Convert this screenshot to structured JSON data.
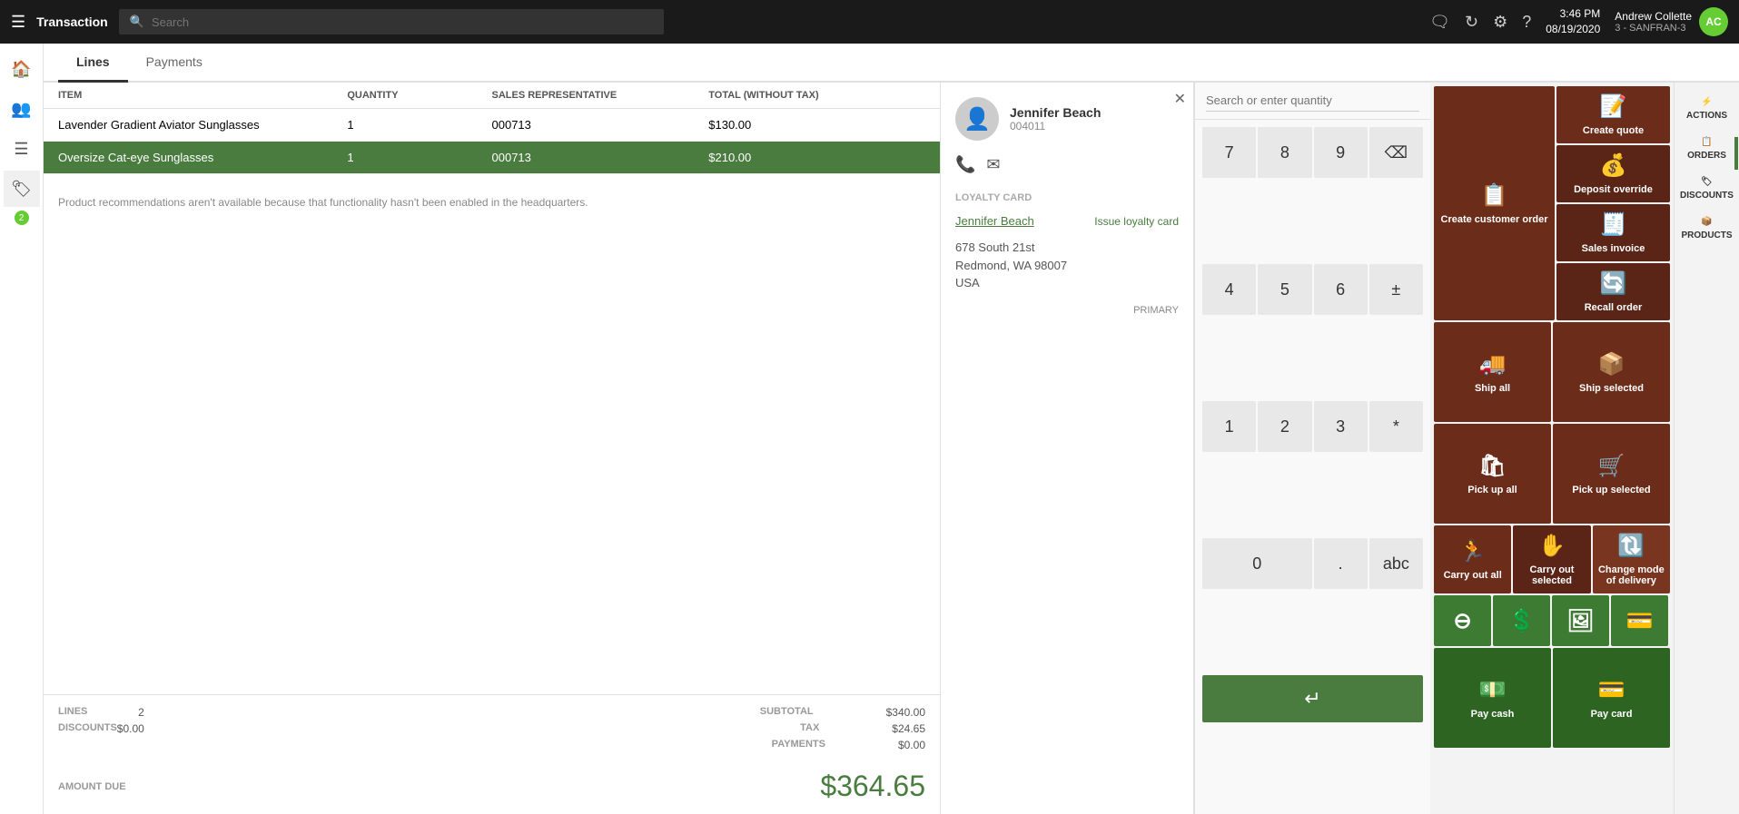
{
  "topbar": {
    "hamburger": "☰",
    "title": "Transaction",
    "search_placeholder": "Search",
    "time": "3:46 PM",
    "date": "08/19/2020",
    "user": "Andrew Collette",
    "store": "3 - SANFRAN-3",
    "avatar_initials": "AC"
  },
  "tabs": [
    {
      "label": "Lines",
      "active": true
    },
    {
      "label": "Payments",
      "active": false
    }
  ],
  "lines_header": {
    "item": "ITEM",
    "quantity": "QUANTITY",
    "sales_rep": "SALES REPRESENTATIVE",
    "total": "TOTAL (WITHOUT TAX)"
  },
  "line_items": [
    {
      "item": "Lavender Gradient Aviator Sunglasses",
      "quantity": "1",
      "sales_rep": "000713",
      "total": "$130.00",
      "selected": false
    },
    {
      "item": "Oversize Cat-eye Sunglasses",
      "quantity": "1",
      "sales_rep": "000713",
      "total": "$210.00",
      "selected": true
    }
  ],
  "notice": "Product recommendations aren't available because that functionality hasn't been enabled in the headquarters.",
  "footer": {
    "lines_label": "LINES",
    "lines_value": "2",
    "discounts_label": "DISCOUNTS",
    "discounts_value": "$0.00",
    "subtotal_label": "SUBTOTAL",
    "subtotal_value": "$340.00",
    "tax_label": "TAX",
    "tax_value": "$24.65",
    "payments_label": "PAYMENTS",
    "payments_value": "$0.00",
    "amount_due_label": "AMOUNT DUE",
    "amount_due_value": "$364.65"
  },
  "customer": {
    "name": "Jennifer Beach",
    "id": "004011",
    "loyalty_card_label": "LOYALTY CARD",
    "loyalty_name": "Jennifer Beach",
    "issue_loyalty_label": "Issue loyalty card",
    "address_line1": "678 South 21st",
    "address_line2": "Redmond, WA 98007",
    "address_line3": "USA",
    "primary_label": "PRIMARY"
  },
  "numpad": {
    "search_placeholder": "Search or enter quantity",
    "buttons": [
      "7",
      "8",
      "9",
      "⌫",
      "4",
      "5",
      "6",
      "±",
      "1",
      "2",
      "3",
      "*",
      "0",
      ".",
      ".",
      "abc"
    ],
    "enter_label": "↵"
  },
  "tiles": {
    "create_customer_order": "Create customer order",
    "create_quote": "Create quote",
    "deposit_override": "Deposit override",
    "sales_invoice": "Sales invoice",
    "recall_order": "Recall order",
    "ship_all": "Ship all",
    "ship_selected": "Ship selected",
    "pick_up_all": "Pick up all",
    "pick_up_selected": "Pick up selected",
    "carry_out_all": "Carry out all",
    "carry_out_selected": "Carry out selected",
    "change_mode_of_delivery": "Change mode of delivery",
    "pay_cash": "Pay cash",
    "pay_card": "Pay card"
  },
  "action_sidebar": {
    "actions_label": "ACTIONS",
    "orders_label": "ORDERS",
    "discounts_label": "DISCOUNTS",
    "products_label": "PRODUCTS"
  }
}
